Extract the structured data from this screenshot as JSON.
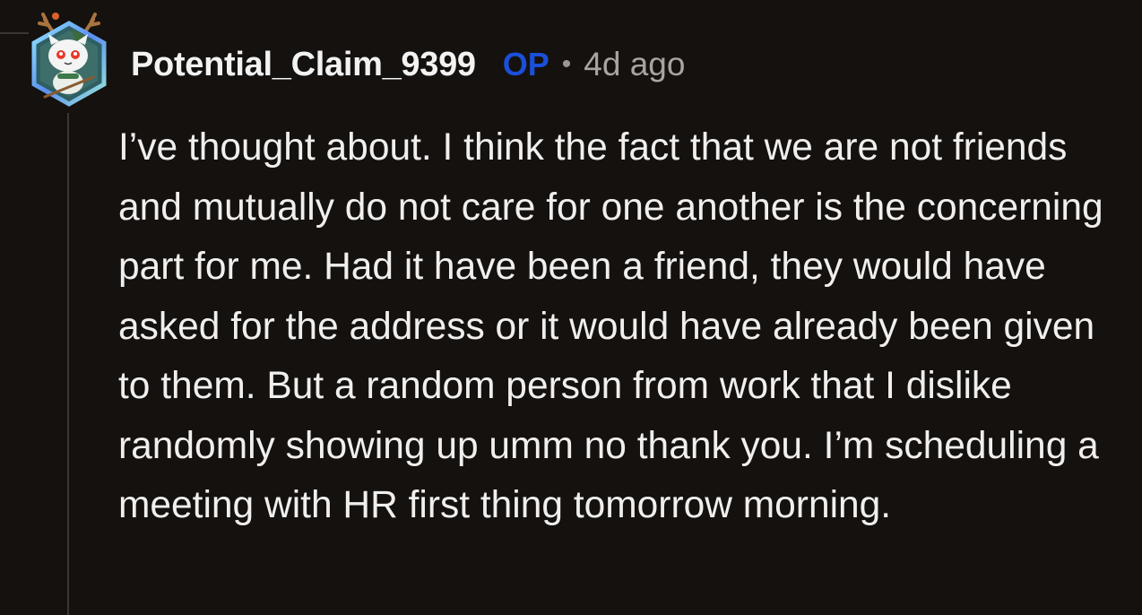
{
  "comment": {
    "author": "Potential_Claim_9399",
    "op_badge": "OP",
    "separator": "•",
    "timestamp": "4d ago",
    "body": "I’ve thought about. I think the fact that we are not friends and mutually do not care for one another is the concerning part for me. Had it have been a friend, they would have asked for the address or it would have already been given to them. But a random person from work that I dislike randomly showing up umm no thank you. I’m scheduling a meeting with HR first thing tomorrow morning.",
    "avatar_icon": "snoo-avatar-icon"
  },
  "colors": {
    "background": "#14110f",
    "username": "#f2f2f2",
    "op_badge": "#1b4fd8",
    "meta": "#a8a4a0",
    "body_text": "#f0efed",
    "thread_line": "#3a3633"
  }
}
